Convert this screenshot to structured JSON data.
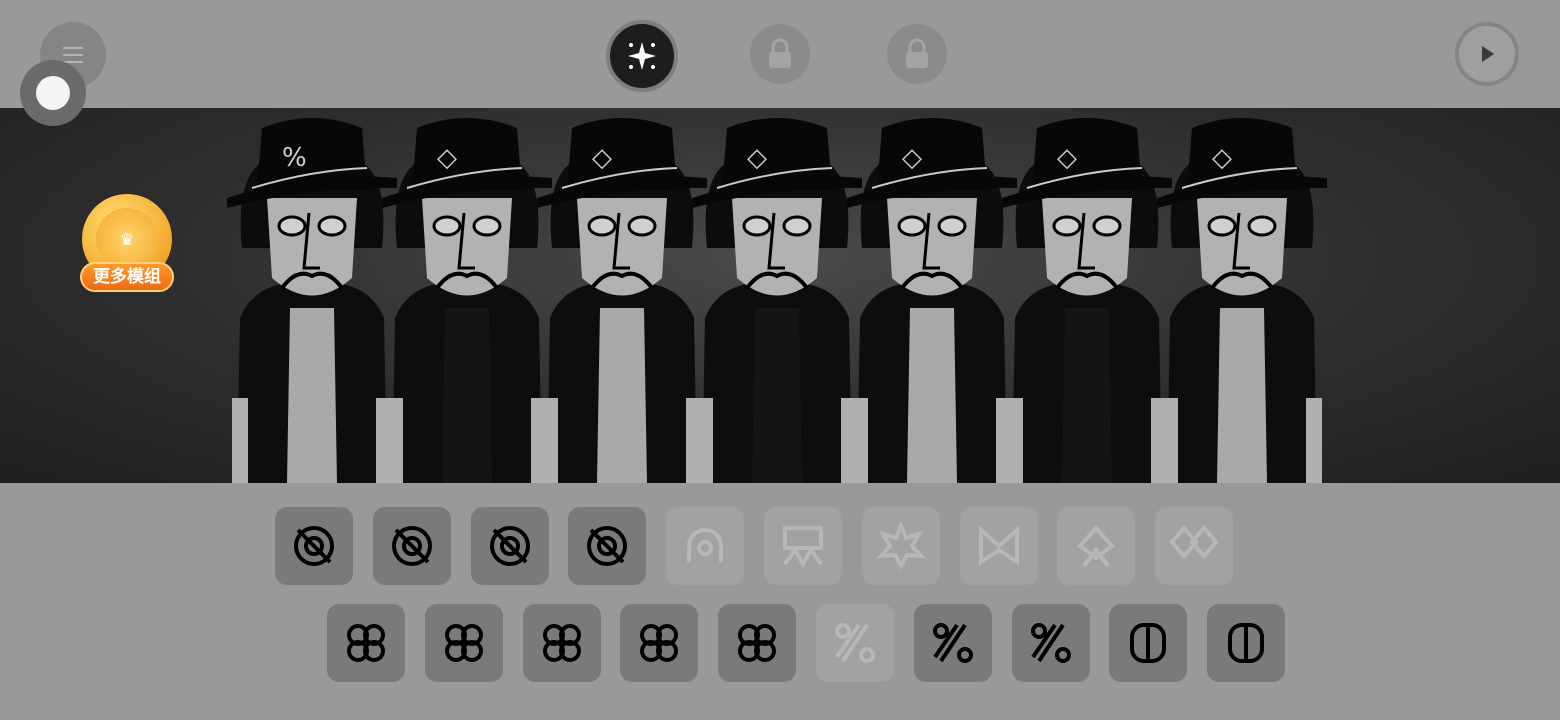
{
  "topbar": {
    "menu_icon": "menu-icon",
    "floating_ball": "floating-ball",
    "magic_icon": "sparkle-icon",
    "locked_slots": [
      "lock-icon",
      "lock-icon"
    ],
    "play_icon": "play-icon"
  },
  "badge": {
    "icon": "vip-crown-coin",
    "label": "更多模组"
  },
  "stage": {
    "characters": [
      "%",
      "diamond-triangle",
      "bow",
      "flag",
      "starburst",
      "arch",
      "double-diamond"
    ]
  },
  "palette": {
    "row1": [
      {
        "icon": "beats-1",
        "active": true
      },
      {
        "icon": "beats-2",
        "active": true
      },
      {
        "icon": "beats-3",
        "active": true
      },
      {
        "icon": "beats-4",
        "active": true
      },
      {
        "icon": "arch",
        "active": false
      },
      {
        "icon": "flag",
        "active": false
      },
      {
        "icon": "starburst",
        "active": false
      },
      {
        "icon": "bow",
        "active": false
      },
      {
        "icon": "diamond-triangle",
        "active": false
      },
      {
        "icon": "double-diamond",
        "active": false
      }
    ],
    "row2": [
      {
        "icon": "clover-1",
        "active": true
      },
      {
        "icon": "clover-2",
        "active": true
      },
      {
        "icon": "clover-3",
        "active": true
      },
      {
        "icon": "clover-4",
        "active": true
      },
      {
        "icon": "clover-5",
        "active": true
      },
      {
        "icon": "percent-1",
        "active": false
      },
      {
        "icon": "percent-2",
        "active": true
      },
      {
        "icon": "percent-3",
        "active": true
      },
      {
        "icon": "voice-1",
        "active": true
      },
      {
        "icon": "voice-2",
        "active": true
      }
    ]
  },
  "colors": {
    "badge_orange": "#f07a14",
    "background": "#9a999a"
  }
}
